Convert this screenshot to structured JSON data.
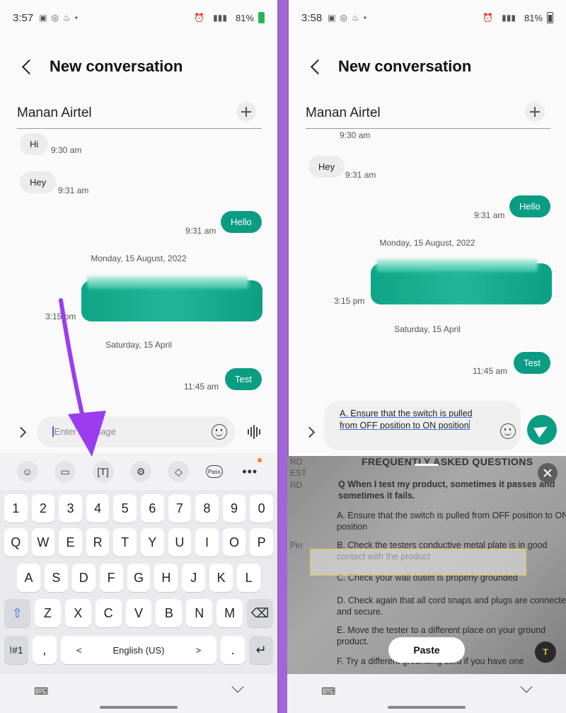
{
  "left": {
    "status": {
      "time": "3:57",
      "battery": "81%"
    },
    "header": {
      "title": "New conversation"
    },
    "recipient": "Manan Airtel",
    "messages": [
      {
        "text": "Hi",
        "time": "9:30 am"
      },
      {
        "text": "Hey",
        "time": "9:31 am"
      },
      {
        "text": "Hello",
        "time": "9:31 am"
      }
    ],
    "date1": "Monday, 15 August, 2022",
    "blurred_time": "3:15 pm",
    "date2": "Saturday, 15 April",
    "test": {
      "text": "Test",
      "time": "11:45 am"
    },
    "compose_placeholder": "Enter message",
    "toolbar_pass": "Pass",
    "toolbar_more": "•••",
    "keyboard": {
      "numbers": [
        "1",
        "2",
        "3",
        "4",
        "5",
        "6",
        "7",
        "8",
        "9",
        "0"
      ],
      "row1": [
        "Q",
        "W",
        "E",
        "R",
        "T",
        "Y",
        "U",
        "I",
        "O",
        "P"
      ],
      "row2": [
        "A",
        "S",
        "D",
        "F",
        "G",
        "H",
        "J",
        "K",
        "L"
      ],
      "row3": [
        "Z",
        "X",
        "C",
        "V",
        "B",
        "N",
        "M"
      ],
      "symbols": "!#1",
      "comma": ",",
      "space": "English (US)",
      "space_left": "<",
      "space_right": ">",
      "period": "."
    }
  },
  "right": {
    "status": {
      "time": "3:58",
      "battery": "81%"
    },
    "header": {
      "title": "New conversation"
    },
    "recipient": "Manan Airtel",
    "top_cut_time": "9:30 am",
    "messages": [
      {
        "text": "Hey",
        "time": "9:31 am"
      },
      {
        "text": "Hello",
        "time": "9:31 am"
      }
    ],
    "date1": "Monday, 15 August, 2022",
    "blurred_time": "3:15 pm",
    "date2": "Saturday, 15 April",
    "test": {
      "text": "Test",
      "time": "11:45 am"
    },
    "typed_text": "A. Ensure that the switch is pulled from OFF position to ON position",
    "camera": {
      "faq": "FREQUENTLY ASKED QUESTIONS",
      "margin": [
        "RD",
        "EST",
        "RD",
        "Pin"
      ],
      "question": "Q When I test my product, sometimes it passes and sometimes it fails.",
      "answers": [
        "A. Ensure that the switch is pulled from OFF position to ON position",
        "B. Check the testers conductive metal plate is in good contact with the product",
        "C. Check your wall outlet is properly grounded",
        "D. Check again that all cord snaps and plugs are connected and secure.",
        "E. Move the tester to a different place on your ground product.",
        "F. Try a different grounding cord if you have one"
      ],
      "paste_label": "Paste",
      "text_button": "T"
    }
  },
  "colors": {
    "accent": "#0a9d83",
    "arrow": "#9b3cf0",
    "selection": "#e6c84a"
  },
  "icons": [
    "back-icon",
    "add-recipient-icon",
    "emoji-icon",
    "clipboard-icon",
    "text-extract-icon",
    "settings-icon",
    "one-hand-icon",
    "pass-icon",
    "more-icon",
    "voice-icon",
    "send-icon",
    "close-icon",
    "keyboard-icon",
    "chevron-down-icon"
  ]
}
